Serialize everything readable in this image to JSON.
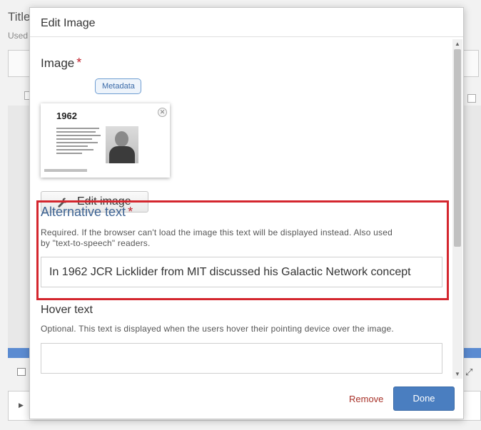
{
  "background": {
    "title": "Title",
    "used_text": "Used"
  },
  "modal": {
    "title": "Edit Image",
    "image_field": {
      "label": "Image",
      "required_mark": "*",
      "metadata_tag": "Metadata",
      "thumbnail_year": "1962",
      "edit_button_label": "Edit image"
    },
    "alt_text": {
      "label": "Alternative text",
      "required_mark": "*",
      "help_line1": "Required. If the browser can't load the image this text will be displayed instead. Also used",
      "help_line2": "by \"text-to-speech\" readers.",
      "value": "In 1962  JCR Licklider from MIT discussed his Galactic Network concept"
    },
    "hover_text": {
      "label": "Hover text",
      "help": "Optional. This text is displayed when the users hover their pointing device over the image.",
      "value": ""
    },
    "footer": {
      "remove_label": "Remove",
      "done_label": "Done"
    }
  },
  "colors": {
    "accent": "#4a7ec0",
    "required": "#c0202b",
    "highlight_border": "#d4262e",
    "alt_title": "#3d6393",
    "remove": "#a8332a"
  },
  "icons": [
    "wrench-icon",
    "close-icon",
    "copy-icon",
    "expand-icon",
    "chevron-right-icon",
    "scroll-up-icon",
    "scroll-down-icon"
  ]
}
